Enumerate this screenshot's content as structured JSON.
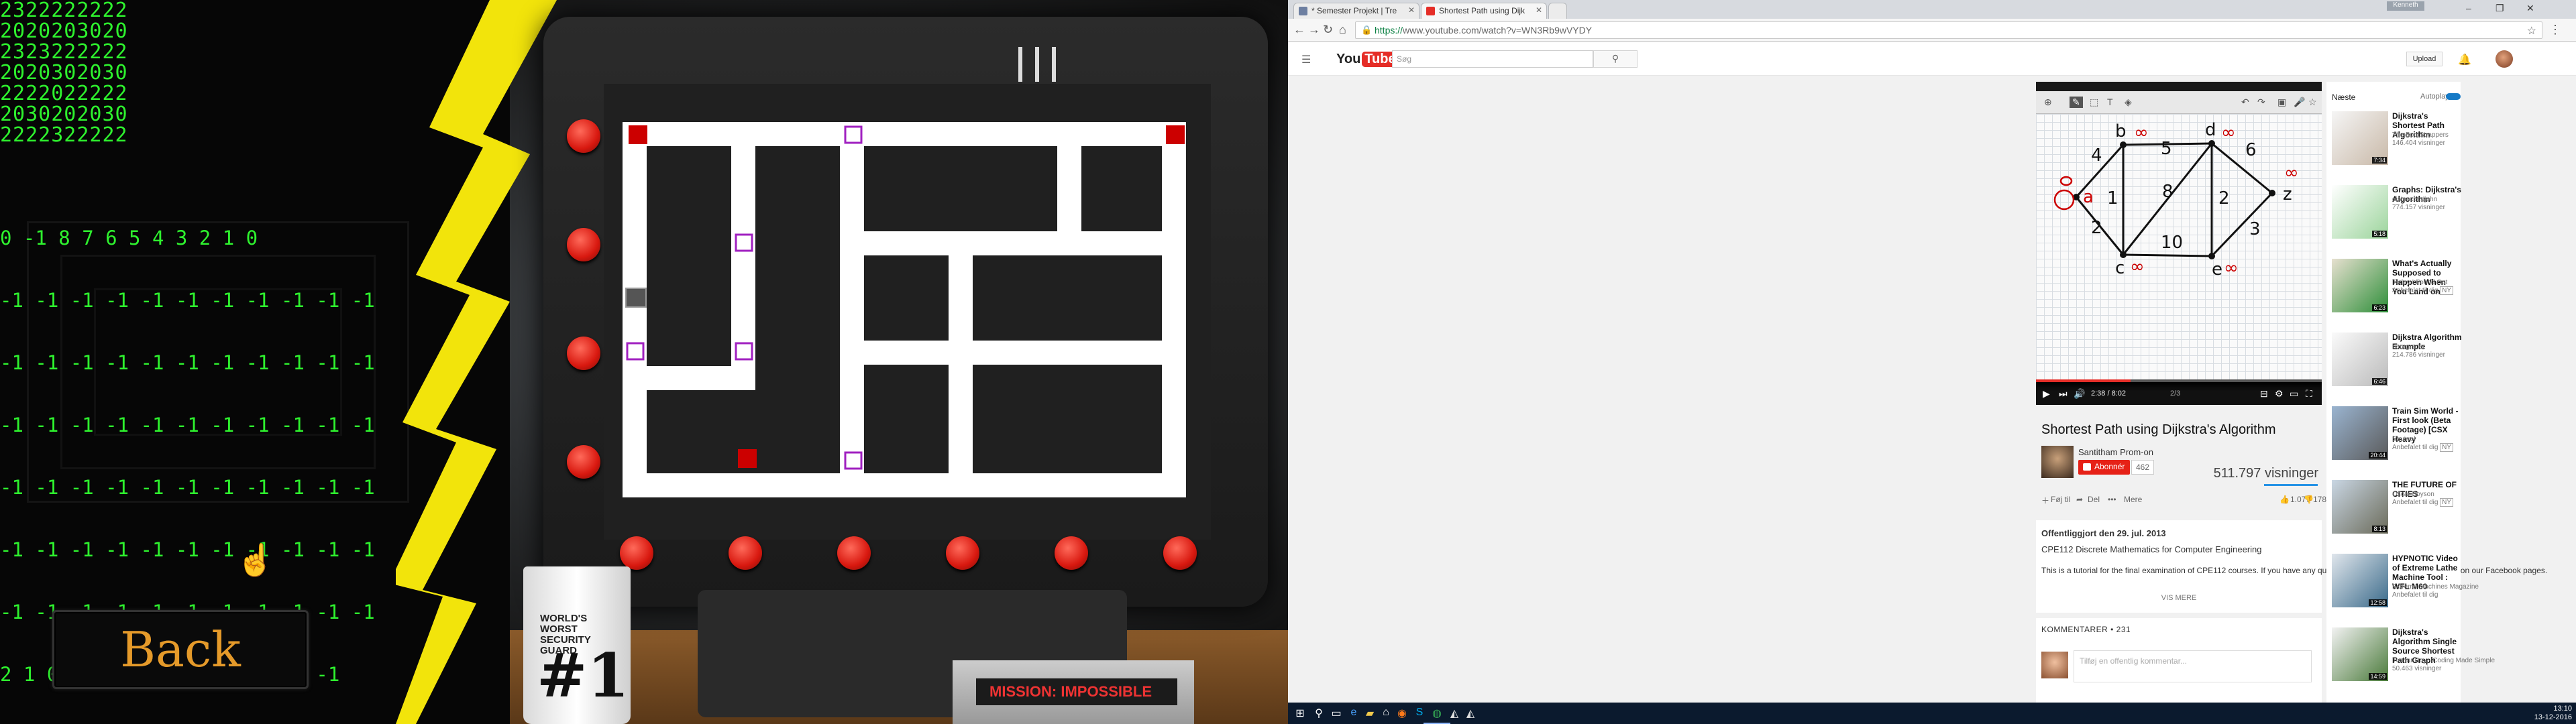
{
  "game": {
    "matrix_rows": [
      "2322222222",
      "2020203020",
      "2323222222",
      "2020302030",
      "2222022222",
      "2030202030",
      "2222322222"
    ],
    "distances_header": "0 -1 8 7 6 5 4 3 2 1 0",
    "distances_rows": [
      "-1 -1 -1 -1 -1 -1 -1 -1 -1 -1 -1",
      "-1 -1 -1 -1 -1 -1 -1 -1 -1 -1 -1",
      "-1 -1 -1 -1 -1 -1 -1 -1 -1 -1 -1",
      "-1 -1 -1 -1 -1 -1 -1 -1 -1 -1 -1",
      "-1 -1 -1 -1 -1 -1 -1 -1 -1 -1 -1",
      "-1 -1 -1 -1 -1 -1 -1 -1 -1 -1 -1",
      "2 1 0 -1 -1 -1 -1 -1 -1 -1 -1"
    ],
    "back_label": "Back",
    "mug_text": "WORLD'S WORST SECURITY GUARD",
    "mug_number": "#1",
    "book_title": "MISSION: IMPOSSIBLE"
  },
  "browser": {
    "tabs": [
      {
        "title": "* Semester Projekt | Tre",
        "favicon_color": "#6d7fa1"
      },
      {
        "title": "Shortest Path using Dijk",
        "favicon_color": "#e52d27"
      }
    ],
    "user_chip": "Kenneth",
    "url_secure": "https://",
    "url_rest": "www.youtube.com/watch?v=WN3Rb9wVYDY"
  },
  "youtube": {
    "logo_you": "You",
    "logo_tube": "Tube",
    "logo_region": "DK",
    "search_placeholder": "Søg",
    "upload_label": "Upload",
    "player": {
      "time": "2:38 / 8:02",
      "page": "2/3",
      "progress_fraction": 0.33
    },
    "video_title": "Shortest Path using Dijkstra's Algorithm",
    "channel_name": "Santitham Prom-on",
    "subscribe_label": "Abonnér",
    "subscriber_count": "462",
    "views": "511.797 visninger",
    "add_to": "Føj til",
    "share": "Del",
    "more": "Mere",
    "likes": "1.077",
    "dislikes": "178",
    "published": "Offentliggjort den 29. jul. 2013",
    "desc_line1": "CPE112 Discrete Mathematics for Computer Engineering",
    "desc_line2": "This is a tutorial for the final examination of CPE112 courses. If you have any questions, please feel free to post them on our Facebook pages.",
    "show_more": "VIS MERE",
    "comments_label": "KOMMENTARER • 231",
    "comment_placeholder": "Tilføj en offentlig kommentar...",
    "sidebar": {
      "next_label": "Næste",
      "autoplay_label": "Autoplay",
      "items": [
        {
          "title": "Dijkstra's Shortest Path Algorithm",
          "channel": "The BootStrappers",
          "views": "146.404 visninger",
          "duration": "7:34"
        },
        {
          "title": "Graphs: Dijkstra's Algorithm",
          "channel": "distanceedjohn",
          "views": "774.157 visninger",
          "duration": "5:18"
        },
        {
          "title": "What's Actually Supposed to Happen When You Land on",
          "channel": "Today I Found Out",
          "views": "Anbefalet til dig",
          "badge": "NY",
          "duration": "6:23"
        },
        {
          "title": "Dijkstra Algorithm Example",
          "channel": "barngrader",
          "views": "214.786 visninger",
          "duration": "6:46"
        },
        {
          "title": "Train Sim World - First look (Beta Footage) [CSX Heavy",
          "channel": "Squirrel",
          "views": "Anbefalet til dig",
          "badge": "NY",
          "duration": "20:44"
        },
        {
          "title": "THE FUTURE OF CITIES",
          "channel": "Oscar Boyson",
          "views": "Anbefalet til dig",
          "badge": "NY",
          "duration": "8:13"
        },
        {
          "title": "HYPNOTIC Video of Extreme Lathe Machine Tool : WFL M60",
          "channel": "Extreme Machines Magazine",
          "views": "Anbefalet til dig",
          "duration": "12:58"
        },
        {
          "title": "Dijkstra's Algorithm Single Source Shortest Path Graph",
          "channel": "Tushar Roy - Coding Made Simple",
          "views": "50.463 visninger",
          "duration": "14:59"
        }
      ]
    }
  },
  "taskbar": {
    "time": "13:10",
    "date": "13-12-2016"
  }
}
